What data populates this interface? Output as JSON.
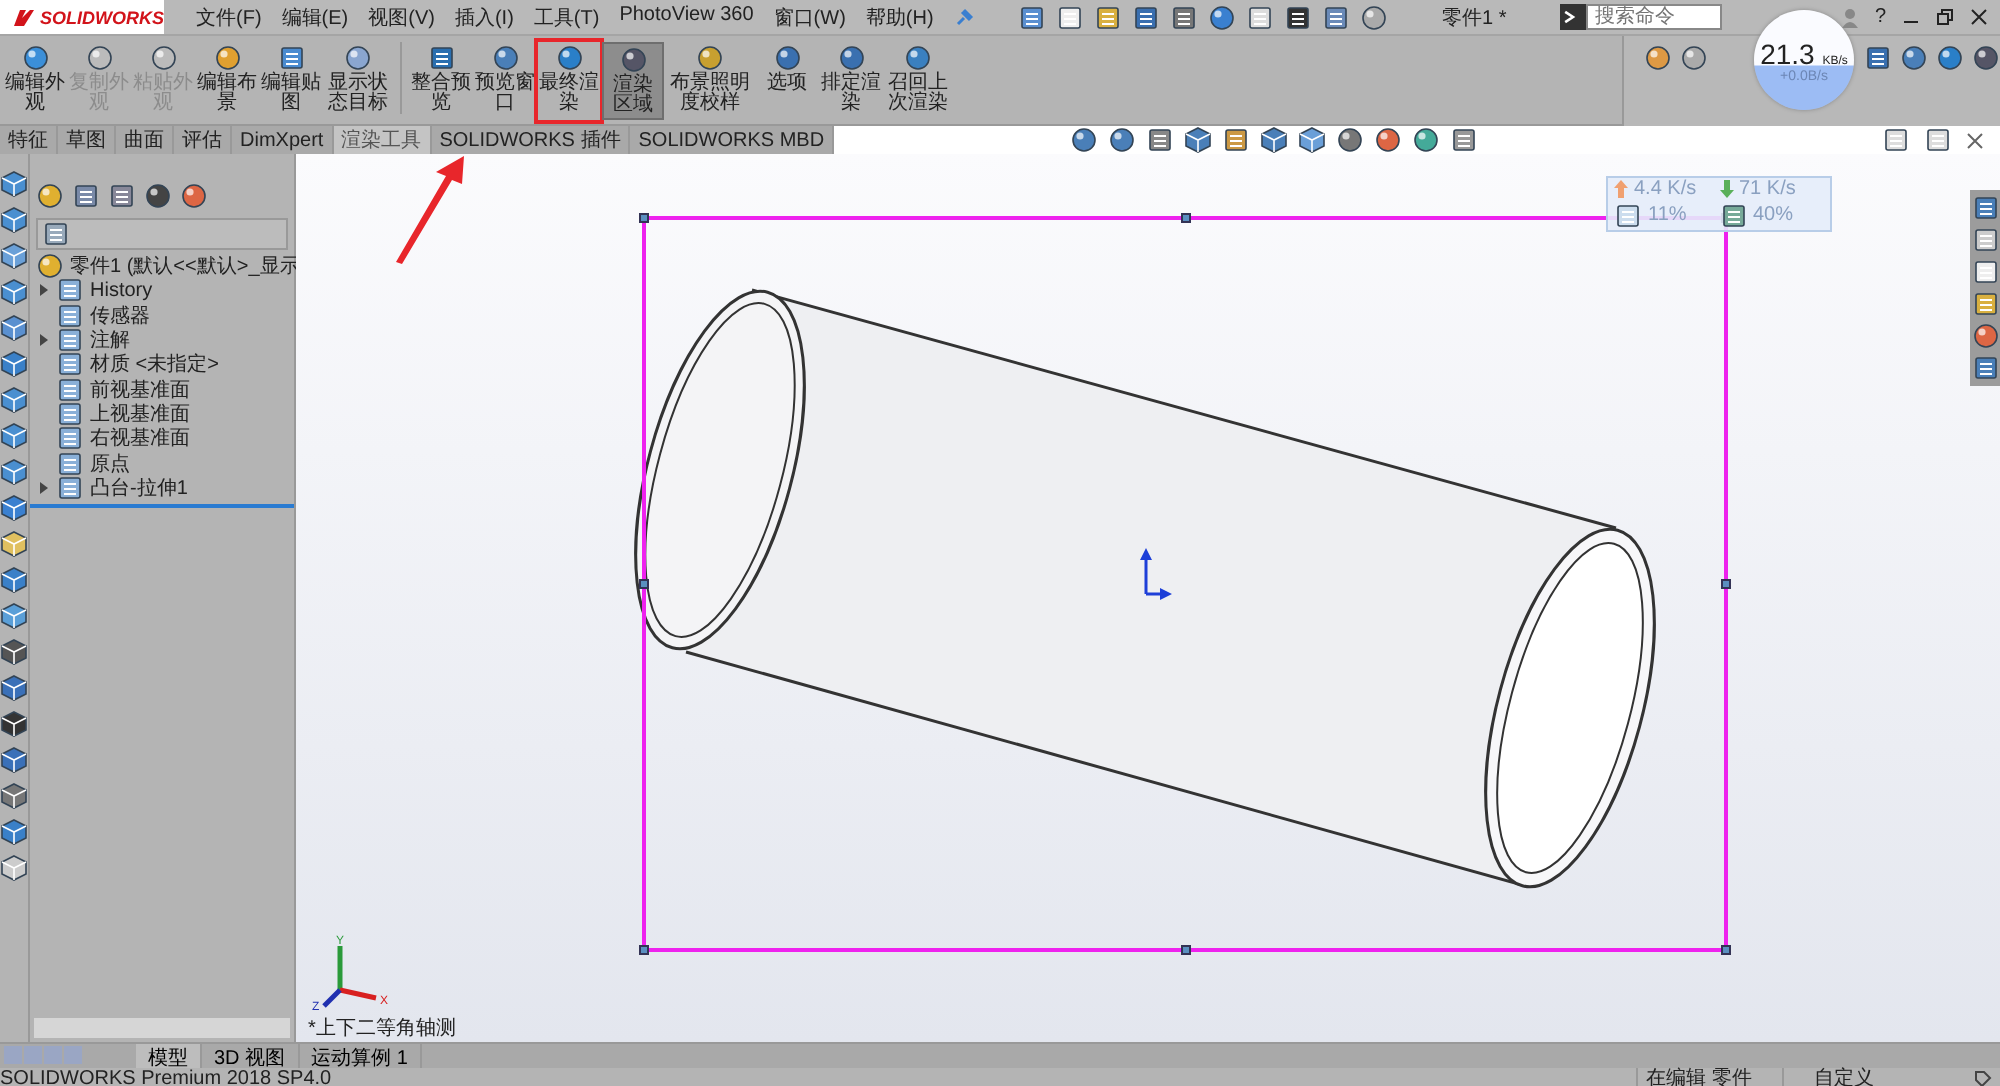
{
  "title_bar": {
    "logo": "SOLIDWORKS",
    "menus": [
      "文件(F)",
      "编辑(E)",
      "视图(V)",
      "插入(I)",
      "工具(T)",
      "PhotoView 360",
      "窗口(W)",
      "帮助(H)"
    ],
    "title": "零件1 *",
    "search": {
      "placeholder": "搜索命令"
    },
    "help": "?"
  },
  "ribbon": {
    "buttons": [
      {
        "label": "编辑外观",
        "disabled": false,
        "selected": false,
        "highlighted": false
      },
      {
        "label": "复制外观",
        "disabled": true,
        "selected": false,
        "highlighted": false
      },
      {
        "label": "粘贴外观",
        "disabled": true,
        "selected": false,
        "highlighted": false
      },
      {
        "label": "编辑布景",
        "disabled": false,
        "selected": false,
        "highlighted": false
      },
      {
        "label": "编辑贴图",
        "disabled": false,
        "selected": false,
        "highlighted": false
      },
      {
        "label": "显示状态目标",
        "disabled": false,
        "selected": false,
        "highlighted": false
      },
      {
        "label": "整合预览",
        "disabled": false,
        "selected": false,
        "highlighted": false
      },
      {
        "label": "预览窗口",
        "disabled": false,
        "selected": false,
        "highlighted": false
      },
      {
        "label": "最终渲染",
        "disabled": false,
        "selected": false,
        "highlighted": true
      },
      {
        "label": "渲染区域",
        "disabled": false,
        "selected": true,
        "highlighted": false
      },
      {
        "label": "布景照明度校样",
        "disabled": false,
        "selected": false,
        "highlighted": false
      },
      {
        "label": "选项",
        "disabled": false,
        "selected": false,
        "highlighted": false
      },
      {
        "label": "排定渲染",
        "disabled": false,
        "selected": false,
        "highlighted": false
      },
      {
        "label": "召回上次渲染",
        "disabled": false,
        "selected": false,
        "highlighted": false
      }
    ]
  },
  "tabs": [
    {
      "label": "特征",
      "selected": false
    },
    {
      "label": "草图",
      "selected": false
    },
    {
      "label": "曲面",
      "selected": false
    },
    {
      "label": "评估",
      "selected": false
    },
    {
      "label": "DimXpert",
      "selected": false
    },
    {
      "label": "渲染工具",
      "selected": true
    },
    {
      "label": "SOLIDWORKS 插件",
      "selected": false
    },
    {
      "label": "SOLIDWORKS MBD",
      "selected": false
    }
  ],
  "feature_tree": {
    "root": "零件1  (默认<<默认>_显示",
    "items": [
      {
        "label": "History",
        "expandable": true
      },
      {
        "label": "传感器",
        "expandable": false
      },
      {
        "label": "注解",
        "expandable": true
      },
      {
        "label": "材质 <未指定>",
        "expandable": false
      },
      {
        "label": "前视基准面",
        "expandable": false
      },
      {
        "label": "上视基准面",
        "expandable": false
      },
      {
        "label": "右视基准面",
        "expandable": false
      },
      {
        "label": "原点",
        "expandable": false
      },
      {
        "label": "凸台-拉伸1",
        "expandable": true
      }
    ]
  },
  "viewport": {
    "view_name": "*上下二等角轴测",
    "triad": [
      "Y",
      "X",
      "Z"
    ]
  },
  "network_monitor": {
    "upload": "4.4 K/s",
    "download": "71 K/s",
    "cpu": "11%",
    "memory": "40%",
    "speed": "21.3",
    "speed_unit": "KB/s",
    "delta": "+0.0B/s"
  },
  "bottom_tabs": [
    {
      "label": "模型",
      "selected": true
    },
    {
      "label": "3D 视图",
      "selected": false
    },
    {
      "label": "运动算例 1",
      "selected": false
    }
  ],
  "status_bar": {
    "product": "SOLIDWORKS Premium 2018 SP4.0",
    "mode": "在编辑 零件",
    "units": "自定义"
  }
}
